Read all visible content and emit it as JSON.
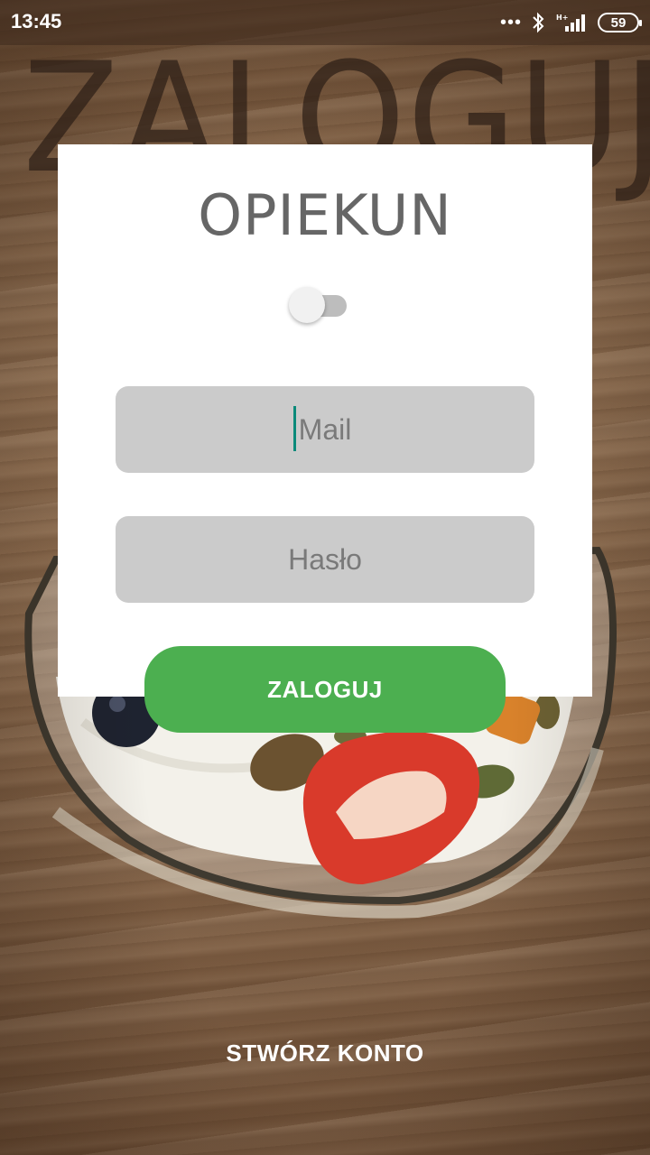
{
  "status_bar": {
    "time": "13:45",
    "battery": "59",
    "icons": [
      "more-dots-icon",
      "bluetooth-icon",
      "signal-icon",
      "battery-icon"
    ]
  },
  "background_title": "ZALOGUJ",
  "card": {
    "title": "OPIEKUN",
    "toggle_on": false
  },
  "form": {
    "mail_placeholder": "Mail",
    "password_placeholder": "Hasło",
    "login_label": "ZALOGUJ"
  },
  "create_account_label": "STWÓRZ KONTO",
  "colors": {
    "accent_green": "#4caf50",
    "field_bg": "#cbcbcb",
    "caret": "#0b8a7a"
  }
}
